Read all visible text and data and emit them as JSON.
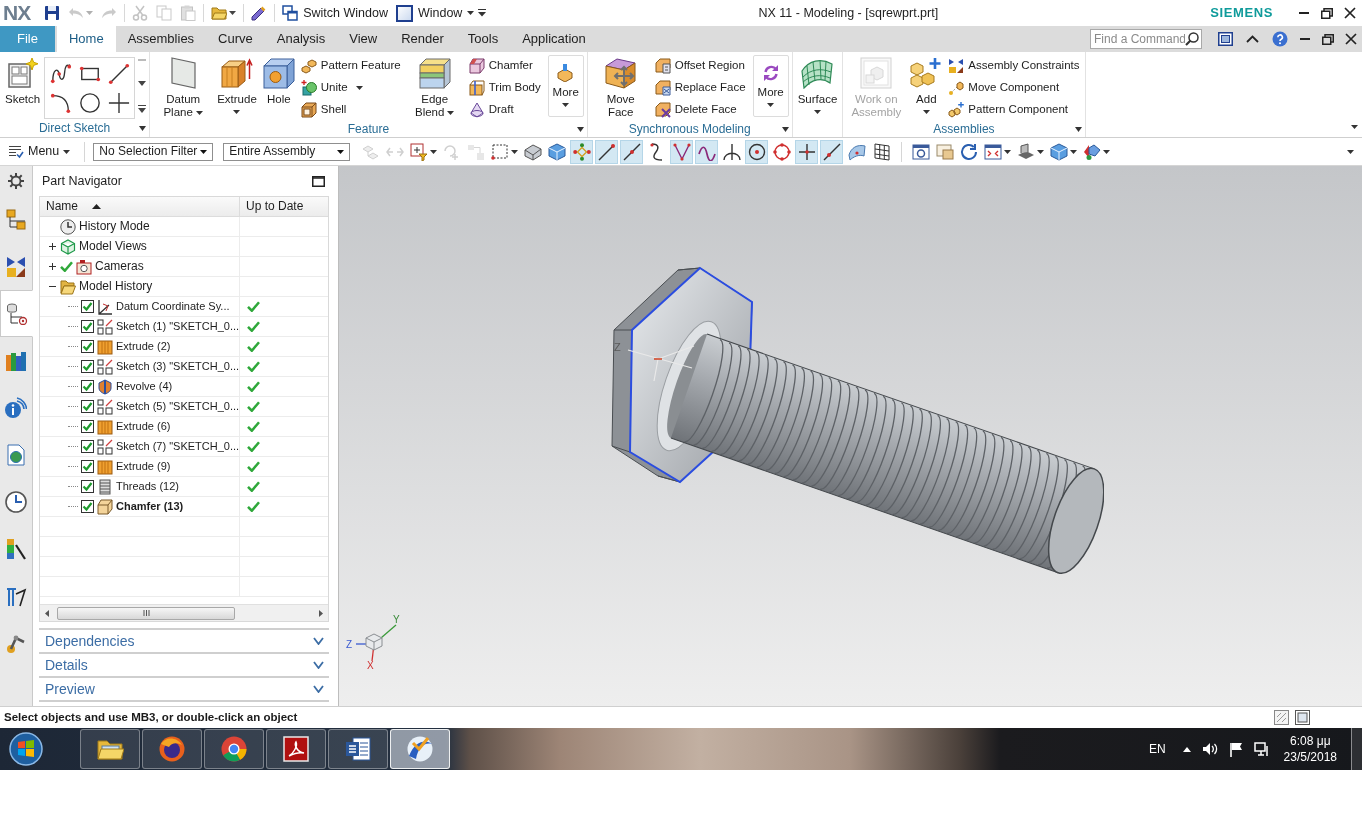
{
  "title_bar": {
    "logo": "NX",
    "switch_window": "Switch Window",
    "window_menu": "Window",
    "title": "NX 11 - Modeling - [sqrewprt.prt]",
    "brand": "SIEMENS"
  },
  "quick_access": [
    {
      "disabled": false,
      "menu": false
    },
    {
      "disabled": true,
      "menu": true
    },
    {
      "disabled": true,
      "menu": false
    },
    {
      "disabled": true,
      "menu": false
    },
    {
      "disabled": true,
      "menu": false
    },
    {
      "disabled": true,
      "menu": false
    },
    {
      "disabled": false,
      "menu": true
    },
    {
      "disabled": false,
      "menu": false
    }
  ],
  "ribbon": {
    "tabs": [
      {
        "label": "File",
        "kind": "file",
        "selected": false
      },
      {
        "label": "Home",
        "kind": "tab",
        "selected": true
      },
      {
        "label": "Assemblies",
        "kind": "tab",
        "selected": false
      },
      {
        "label": "Curve",
        "kind": "tab",
        "selected": false
      },
      {
        "label": "Analysis",
        "kind": "tab",
        "selected": false
      },
      {
        "label": "View",
        "kind": "tab",
        "selected": false
      },
      {
        "label": "Render",
        "kind": "tab",
        "selected": false
      },
      {
        "label": "Tools",
        "kind": "tab",
        "selected": false
      },
      {
        "label": "Application",
        "kind": "tab",
        "selected": false
      }
    ],
    "command_finder": {
      "placeholder": "Find a Command"
    },
    "groups": [
      {
        "label": "Direct Sketch",
        "launcher": true,
        "items": [
          {
            "kind": "large",
            "label": "Sketch",
            "menu": false
          },
          {
            "kind": "gallery"
          }
        ]
      },
      {
        "label": "Feature",
        "launcher": true,
        "items": [
          {
            "kind": "large",
            "label": "Datum Plane",
            "menu": true
          },
          {
            "kind": "large",
            "label": "Extrude",
            "menu": true
          },
          {
            "kind": "large",
            "label": "Hole",
            "menu": false
          },
          {
            "kind": "small",
            "label": "Pattern Feature",
            "menu": false
          },
          {
            "kind": "small",
            "label": "Unite",
            "menu": true
          },
          {
            "kind": "small",
            "label": "Shell",
            "menu": false
          },
          {
            "kind": "large",
            "label": "Edge Blend",
            "menu": true
          },
          {
            "kind": "small",
            "label": "Chamfer",
            "menu": false
          },
          {
            "kind": "small",
            "label": "Trim Body",
            "menu": false
          },
          {
            "kind": "small",
            "label": "Draft",
            "menu": false
          },
          {
            "kind": "more",
            "label": "More",
            "menu": true
          }
        ]
      },
      {
        "label": "Synchronous Modeling",
        "launcher": true,
        "items": [
          {
            "kind": "large",
            "label": "Move Face",
            "menu": false
          },
          {
            "kind": "small",
            "label": "Offset Region",
            "menu": false
          },
          {
            "kind": "small",
            "label": "Replace Face",
            "menu": false
          },
          {
            "kind": "small",
            "label": "Delete Face",
            "menu": false
          },
          {
            "kind": "more",
            "label": "More",
            "menu": true
          }
        ]
      },
      {
        "launcher": false,
        "items": [
          {
            "kind": "large",
            "label": "Surface",
            "menu": true
          }
        ]
      },
      {
        "label": "Assemblies",
        "launcher": true,
        "items": [
          {
            "kind": "large",
            "label": "Work on Assembly",
            "menu": false,
            "disabled": true
          },
          {
            "kind": "large",
            "label": "Add",
            "menu": true,
            "disabled": false
          },
          {
            "kind": "small",
            "label": "Assembly Constraints",
            "menu": false,
            "disabled": false
          },
          {
            "kind": "small",
            "label": "Move Component",
            "menu": false,
            "disabled": false
          },
          {
            "kind": "small",
            "label": "Pattern Component",
            "menu": false,
            "disabled": false
          }
        ]
      }
    ]
  },
  "toolbar": {
    "menu_label": "Menu",
    "selection_filter": "No Selection Filter",
    "assembly_scope": "Entire Assembly",
    "selection_tools": [
      {
        "disabled": true,
        "menu": false
      },
      {
        "disabled": true,
        "menu": false
      },
      {
        "disabled": false,
        "menu": true
      },
      {
        "disabled": true,
        "menu": false
      },
      {
        "disabled": true,
        "menu": false
      },
      {
        "disabled": false,
        "menu": true
      },
      {
        "disabled": false,
        "menu": false
      },
      {
        "disabled": false,
        "menu": false
      }
    ],
    "snap_tools": [
      {
        "on": true
      },
      {
        "on": true
      },
      {
        "on": true
      },
      {
        "on": false
      },
      {
        "on": true
      },
      {
        "on": true
      },
      {
        "on": false
      },
      {
        "on": true
      },
      {
        "on": false
      },
      {
        "on": true
      },
      {
        "on": true
      },
      {
        "on": false
      },
      {
        "on": false
      }
    ],
    "view_tools": [
      {
        "menu": false
      },
      {
        "menu": false
      },
      {
        "menu": false
      },
      {
        "menu": true
      },
      {
        "menu": true
      },
      {
        "menu": true
      },
      {
        "menu": true
      }
    ]
  },
  "resource_bar": [
    {
      "selected": false
    },
    {
      "selected": false
    },
    {
      "selected": false
    },
    {
      "selected": true
    },
    {
      "selected": false
    },
    {
      "selected": false
    },
    {
      "selected": false
    },
    {
      "selected": false
    },
    {
      "selected": false
    },
    {
      "selected": false
    },
    {
      "selected": false
    }
  ],
  "navigator": {
    "title": "Part Navigator",
    "columns": [
      {
        "label": "Name",
        "sorted": true
      },
      {
        "label": "Up to Date",
        "sorted": false
      }
    ],
    "tree": [
      {
        "label": "History Mode",
        "kind": "mode",
        "checked": false
      },
      {
        "label": "Model Views",
        "kind": "views",
        "checked": false,
        "expanded": false
      },
      {
        "label": "Cameras",
        "kind": "cameras",
        "checked": true,
        "expanded": false
      },
      {
        "label": "Model History",
        "kind": "folder",
        "checked": false,
        "expanded": true,
        "children": [
          {
            "label": "Datum Coordinate Sy...",
            "kind": "datum",
            "checked": true,
            "up_to_date": true,
            "current": false
          },
          {
            "label": "Sketch (1) \"SKETCH_0...",
            "kind": "sketch",
            "checked": true,
            "up_to_date": true,
            "current": false
          },
          {
            "label": "Extrude (2)",
            "kind": "extrude",
            "checked": true,
            "up_to_date": true,
            "current": false
          },
          {
            "label": "Sketch (3) \"SKETCH_0...",
            "kind": "sketch",
            "checked": true,
            "up_to_date": true,
            "current": false
          },
          {
            "label": "Revolve (4)",
            "kind": "revolve",
            "checked": true,
            "up_to_date": true,
            "current": false
          },
          {
            "label": "Sketch (5) \"SKETCH_0...",
            "kind": "sketch",
            "checked": true,
            "up_to_date": true,
            "current": false
          },
          {
            "label": "Extrude (6)",
            "kind": "extrude",
            "checked": true,
            "up_to_date": true,
            "current": false
          },
          {
            "label": "Sketch (7) \"SKETCH_0...",
            "kind": "sketch",
            "checked": true,
            "up_to_date": true,
            "current": false
          },
          {
            "label": "Extrude (9)",
            "kind": "extrude",
            "checked": true,
            "up_to_date": true,
            "current": false
          },
          {
            "label": "Threads (12)",
            "kind": "threads",
            "checked": true,
            "up_to_date": true,
            "current": false
          },
          {
            "label": "Chamfer (13)",
            "kind": "chamfer",
            "checked": true,
            "up_to_date": true,
            "current": true
          }
        ]
      }
    ],
    "sections": [
      {
        "label": "Dependencies",
        "expanded": false
      },
      {
        "label": "Details",
        "expanded": false
      },
      {
        "label": "Preview",
        "expanded": false
      }
    ]
  },
  "viewport": {
    "datum_label": "Z",
    "triad_labels": [
      "Y",
      "Z",
      "X"
    ]
  },
  "status_bar": {
    "prompt": "Select objects and use MB3, or double-click an object"
  },
  "taskbar": {
    "apps": [
      {
        "selected": false
      },
      {
        "selected": false
      },
      {
        "selected": false
      },
      {
        "selected": false
      },
      {
        "selected": false
      },
      {
        "selected": true
      }
    ],
    "language": "EN",
    "time": "6:08 μμ",
    "date": "23/5/2018"
  }
}
